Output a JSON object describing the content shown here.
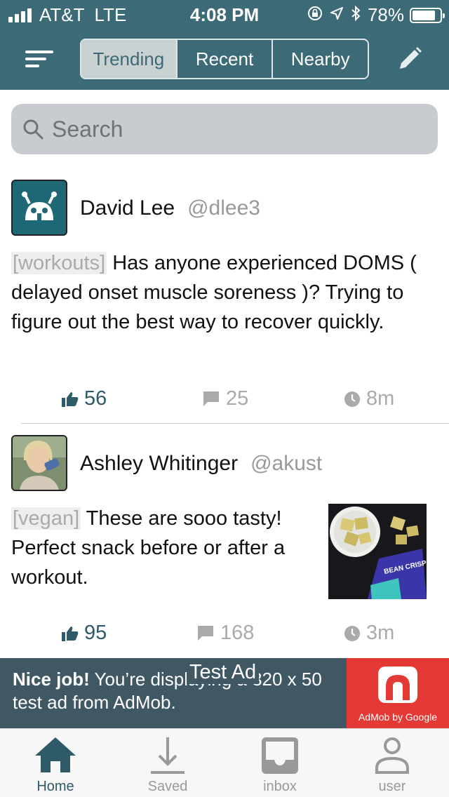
{
  "status_bar": {
    "carrier": "AT&T",
    "network": "LTE",
    "time": "4:08 PM",
    "battery": "78%"
  },
  "nav": {
    "tabs": [
      {
        "label": "Trending",
        "active": true
      },
      {
        "label": "Recent",
        "active": false
      },
      {
        "label": "Nearby",
        "active": false
      }
    ]
  },
  "search": {
    "placeholder": "Search"
  },
  "posts": [
    {
      "author": "David Lee",
      "handle": "@dlee3",
      "tag": "[workouts]",
      "text": " Has anyone experienced DOMS ( delayed onset muscle soreness )? Trying to figure out the best way to recover quickly.",
      "likes": "56",
      "comments": "25",
      "time": "8m"
    },
    {
      "author": "Ashley Whitinger",
      "handle": "@akust",
      "tag": "[vegan]",
      "text": " These are sooo tasty! Perfect snack before or after a workout.",
      "likes": "95",
      "comments": "168",
      "time": "3m",
      "image_text": "BEAN CRISPS"
    }
  ],
  "ad": {
    "bold": "Nice job!",
    "text": " You’re displaying a 320 x 50 test ad from AdMob.",
    "badge": "Test Ad",
    "brand": "AdMob by Google"
  },
  "tab_bar": {
    "items": [
      {
        "label": "Home",
        "icon": "home-icon",
        "active": true
      },
      {
        "label": "Saved",
        "icon": "download-icon",
        "active": false
      },
      {
        "label": "inbox",
        "icon": "inbox-icon",
        "active": false
      },
      {
        "label": "user",
        "icon": "user-icon",
        "active": false
      }
    ]
  },
  "colors": {
    "header": "#3c6a76",
    "accent": "#2f5a68",
    "ad_background": "#3f5864",
    "admob_red": "#e53935"
  }
}
